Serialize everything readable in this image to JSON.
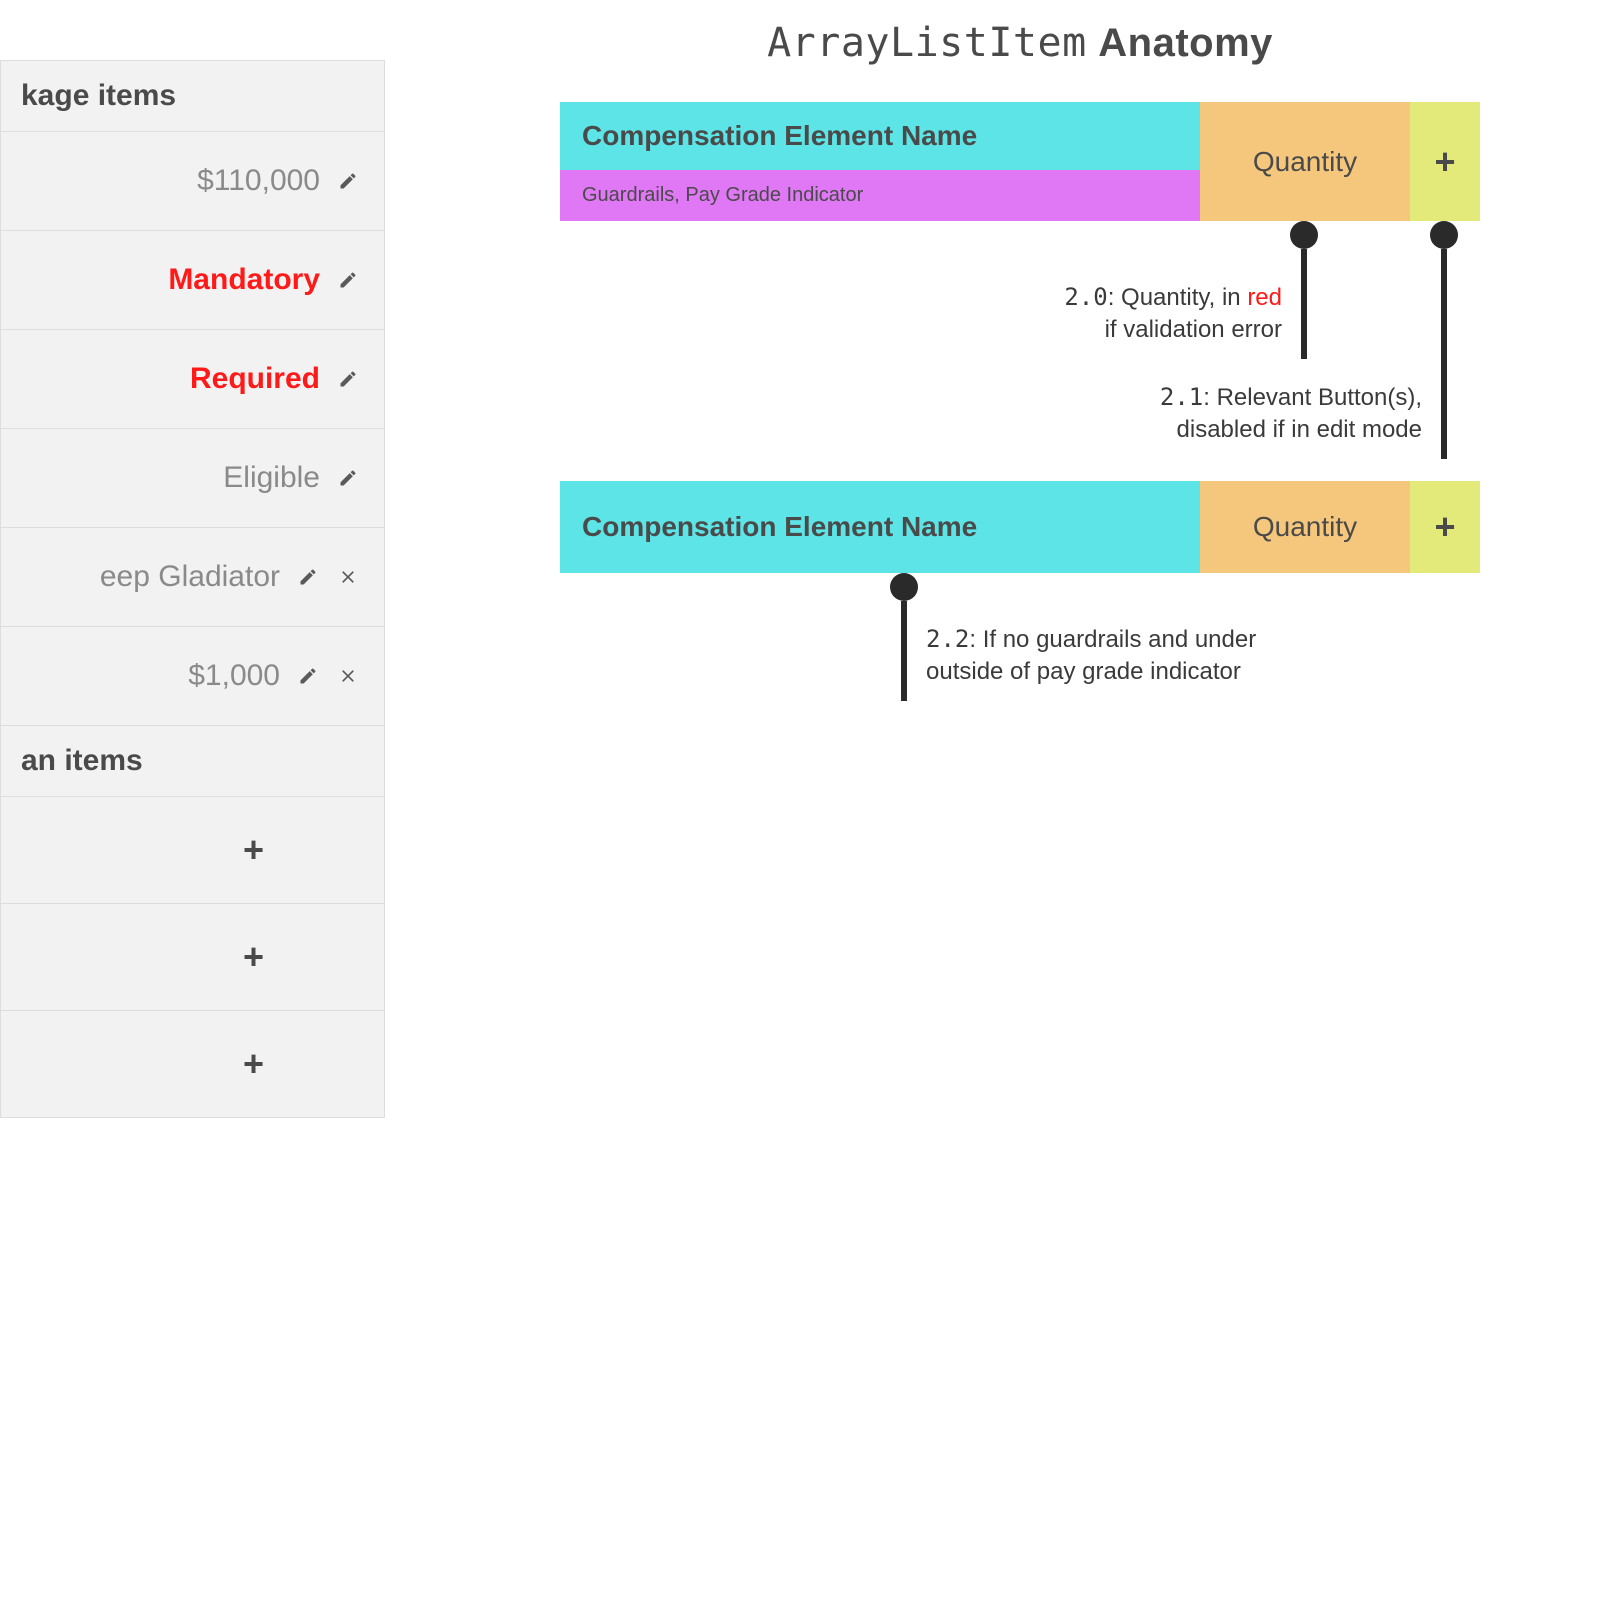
{
  "sidebar": {
    "header1": "kage items",
    "header2": "an items",
    "rows": [
      {
        "value": "$110,000",
        "style": "grey",
        "edit": true,
        "remove": false
      },
      {
        "value": "Mandatory",
        "style": "red",
        "edit": true,
        "remove": false
      },
      {
        "value": "Required",
        "style": "red",
        "edit": true,
        "remove": false
      },
      {
        "value": "Eligible",
        "style": "grey",
        "edit": true,
        "remove": false
      },
      {
        "value": "eep Gladiator",
        "style": "grey",
        "edit": true,
        "remove": true
      },
      {
        "value": "$1,000",
        "style": "grey",
        "edit": true,
        "remove": true
      }
    ],
    "plus": "+"
  },
  "anatomy": {
    "title_mono": "ArrayListItem",
    "title_bold": "Anatomy",
    "block1": {
      "name": "Compensation Element Name",
      "guardrails": "Guardrails, Pay Grade Indicator",
      "quantity": "Quantity",
      "button": "+"
    },
    "block2": {
      "name": "Compensation Element Name",
      "quantity": "Quantity",
      "button": "+"
    },
    "annotations": {
      "a1_num": "2.0",
      "a1_text_pre": ": Quantity, in ",
      "a1_red": "red",
      "a1_text_post": "if validation error",
      "a2_num": "2.1",
      "a2_text1": ": Relevant Button(s),",
      "a2_text2": "disabled if in edit mode",
      "a3_num": "2.2",
      "a3_text1": ": If no guardrails and under",
      "a3_text2": "outside of pay grade indicator"
    }
  }
}
